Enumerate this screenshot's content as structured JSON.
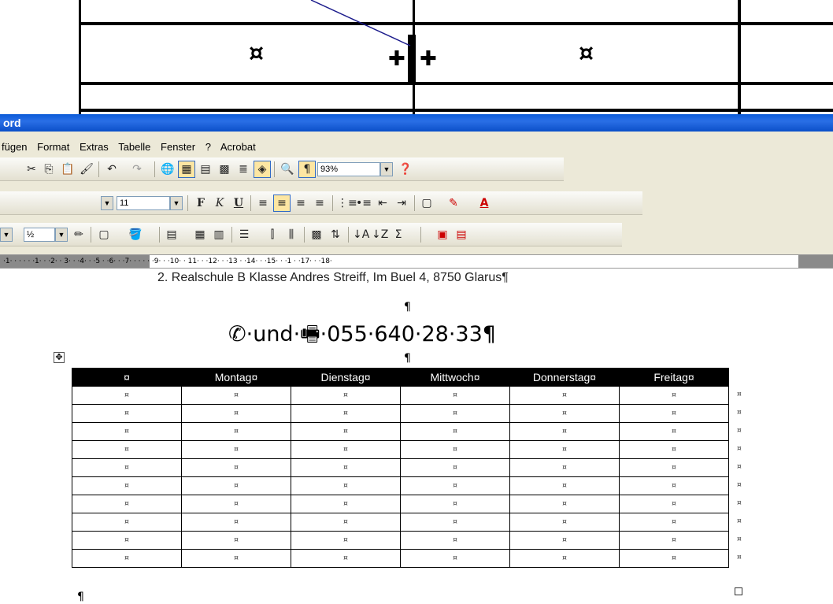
{
  "zoom_callout": {
    "cell_marks": [
      "¤",
      "¤"
    ]
  },
  "window": {
    "title": "ord"
  },
  "menu": {
    "items": [
      "fügen",
      "Format",
      "Extras",
      "Tabelle",
      "Fenster",
      "?",
      "Acrobat"
    ]
  },
  "toolbar_standard": {
    "zoom_value": "93%"
  },
  "toolbar_format": {
    "font_size": "11"
  },
  "toolbar_tables": {
    "line_weight": "½"
  },
  "ruler": {
    "text": "·1· · ·  · · ·1· · ·2· ·  3· · ·4· · ·5  · ·6· · ·7· · ·  · · ·9· · ·10· ·  11· · ·12· · ·13  · ·14· · ·15· · ·1  · ·17· · ·18·"
  },
  "document": {
    "subtitle": "2. Realschule B Klasse Andres Streiff, Im Buel 4, 8750 Glarus¶",
    "pilcrow": "¶",
    "phone_line": "✆·und·🖷·055·640·28·33¶",
    "end_pilcrow": "¶",
    "table": {
      "headers": [
        "¤",
        "Montag¤",
        "Dienstag¤",
        "Mittwoch¤",
        "Donnerstag¤",
        "Freitag¤"
      ],
      "empty_cell": "¤",
      "row_count": 10,
      "row_end_mark": "¤"
    }
  },
  "colors": {
    "titlebar": "#0a5bd8",
    "toolbar": "#ece9d8",
    "header_bg": "#000000"
  }
}
